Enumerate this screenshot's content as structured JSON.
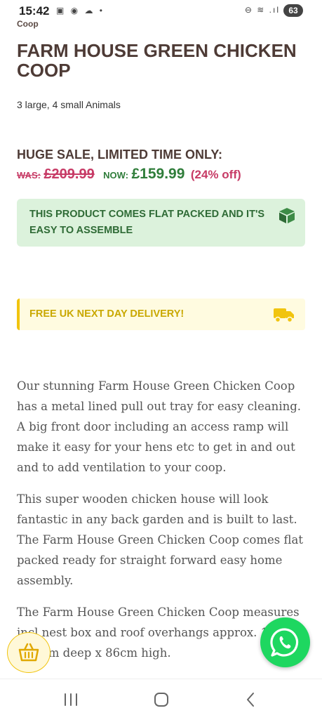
{
  "status_bar": {
    "time": "15:42",
    "left_icons": "▣ ◉ ☁ •",
    "right_icons": "⊖ ≋ .ıl",
    "battery": "63"
  },
  "breadcrumb": "Coop",
  "product": {
    "title": "FARM HOUSE GREEN CHICKEN COOP",
    "subtitle": "3 large, 4 small Animals",
    "sale_heading": "HUGE SALE, LIMITED TIME ONLY:",
    "was_label": "WAS:",
    "was_price": "£209.99",
    "now_label": "NOW:",
    "now_price": "£159.99",
    "discount": "(24% off)"
  },
  "notices": {
    "flat_packed": "THIS PRODUCT COMES FLAT PACKED AND IT'S EASY TO ASSEMBLE",
    "delivery": "FREE UK NEXT DAY DELIVERY!"
  },
  "description": {
    "p1": "Our stunning Farm House Green Chicken Coop has a metal lined pull out tray for easy cleaning. A big front door including an access ramp will make it easy for your hens etc to get in and out and to add ventilation to your coop.",
    "p2": "This super wooden chicken house will look fantastic in any back garden and is built to last. The Farm House Green Chicken Coop comes flat packed ready for straight forward easy home assembly.",
    "p3": "The Farm House Green Chicken Coop measures incl nest box and roof overhangs approx. 165cm x 68cm deep x 86cm high."
  },
  "colors": {
    "title": "#4e3b36",
    "sale_red": "#c73b66",
    "now_green": "#2f7d3a",
    "flat_bg": "#dcf2dc",
    "delivery_bg": "#fffbe0",
    "delivery_accent": "#f1c40f",
    "whatsapp": "#1ed760"
  },
  "icons": {
    "flat_pack": "box-icon",
    "delivery": "truck-icon",
    "cart": "basket-icon",
    "chat": "whatsapp-icon",
    "nav_recent": "recent-apps-icon",
    "nav_home": "home-icon",
    "nav_back": "back-icon"
  }
}
